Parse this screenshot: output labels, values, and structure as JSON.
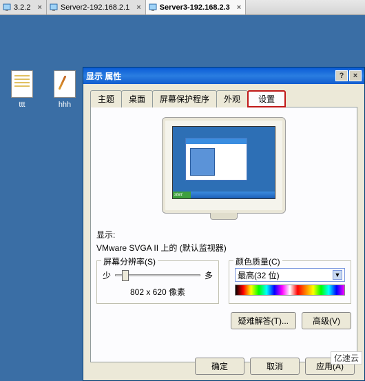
{
  "tabs_bar": {
    "items": [
      {
        "name": "3.2.2",
        "active": false
      },
      {
        "name": "Server2-192.168.2.1",
        "active": false
      },
      {
        "name": "Server3-192.168.2.3",
        "active": true
      }
    ]
  },
  "desktop": {
    "icons": [
      {
        "label": "ttt",
        "kind": "notepad"
      },
      {
        "label": "hhh",
        "kind": "brush"
      }
    ]
  },
  "dialog": {
    "title": "显示 属性",
    "help": "?",
    "close": "×",
    "tabs": [
      {
        "label": "主题"
      },
      {
        "label": "桌面"
      },
      {
        "label": "屏幕保护程序"
      },
      {
        "label": "外观"
      },
      {
        "label": "设置",
        "selected": true,
        "highlighted": true
      }
    ],
    "preview": {
      "start_label": "start"
    },
    "display_label": "显示:",
    "display_desc": "VMware SVGA II 上的 (默认监视器)",
    "resolution": {
      "legend": "屏幕分辨率(S)",
      "min": "少",
      "max": "多",
      "value": "802 x 620 像素"
    },
    "color": {
      "legend": "颜色质量(C)",
      "selected": "最高(32 位)"
    },
    "buttons": {
      "troubleshoot": "疑难解答(T)...",
      "advanced": "高级(V)",
      "ok": "确定",
      "cancel": "取消",
      "apply": "应用(A)"
    }
  },
  "watermark": "亿速云"
}
